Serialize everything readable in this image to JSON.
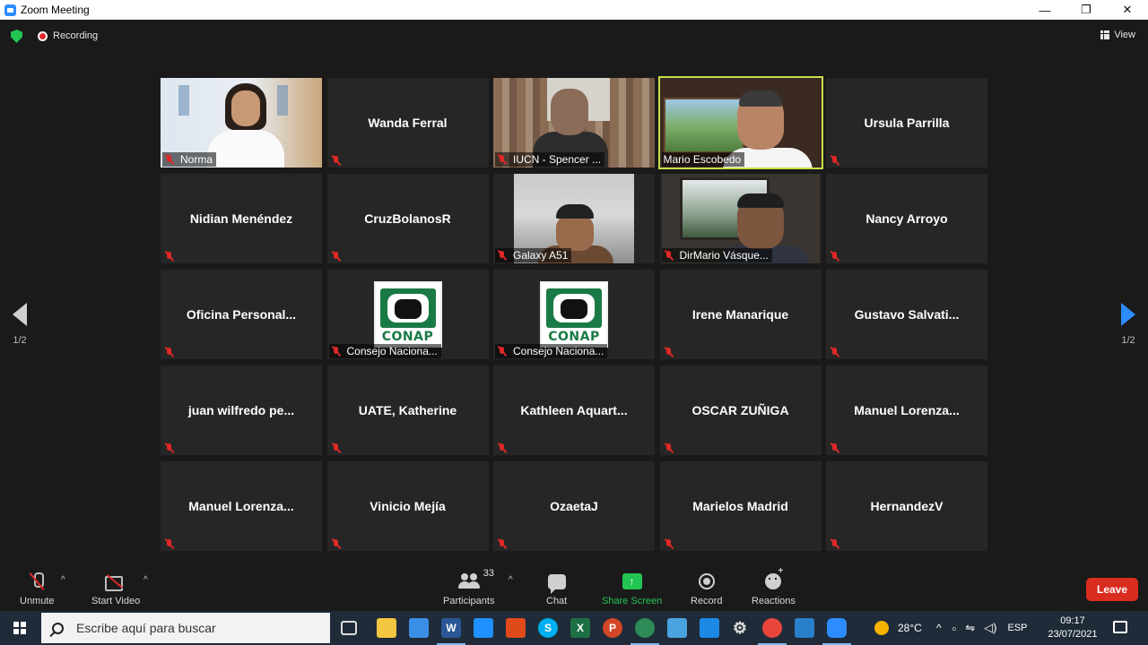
{
  "window": {
    "title": "Zoom Meeting",
    "minimize": "—",
    "restore": "❐",
    "close": "✕"
  },
  "topbar": {
    "recording_label": "Recording",
    "view_label": "View"
  },
  "pagination": {
    "prev_page": "1/2",
    "next_page": "1/2"
  },
  "participants": [
    {
      "name": "Norma",
      "type": "video"
    },
    {
      "name": "Wanda Ferral",
      "type": "name"
    },
    {
      "name": "IUCN - Spencer ...",
      "type": "video"
    },
    {
      "name": "Mario Escobedo",
      "type": "video",
      "active": true
    },
    {
      "name": "Ursula Parrilla",
      "type": "name"
    },
    {
      "name": "Nidian Menéndez",
      "type": "name"
    },
    {
      "name": "CruzBolanosR",
      "type": "name"
    },
    {
      "name": "Galaxy A51",
      "type": "video"
    },
    {
      "name": "DirMario Vásque...",
      "type": "video"
    },
    {
      "name": "Nancy Arroyo",
      "type": "name"
    },
    {
      "name": "Oficina  Personal...",
      "type": "name"
    },
    {
      "name": "Consejo Naciona...",
      "type": "logo",
      "logo_text": "CONAP"
    },
    {
      "name": "Consejo Naciona...",
      "type": "logo",
      "logo_text": "CONAP"
    },
    {
      "name": "Irene Manarique",
      "type": "name"
    },
    {
      "name": "Gustavo  Salvati...",
      "type": "name"
    },
    {
      "name": "juan  wilfredo  pe...",
      "type": "name"
    },
    {
      "name": "UATE, Katherine",
      "type": "name"
    },
    {
      "name": "Kathleen  Aquart...",
      "type": "name"
    },
    {
      "name": "OSCAR ZUÑIGA",
      "type": "name"
    },
    {
      "name": "Manuel  Lorenza...",
      "type": "name"
    },
    {
      "name": "Manuel  Lorenza...",
      "type": "name"
    },
    {
      "name": "Vinicio Mejía",
      "type": "name"
    },
    {
      "name": "OzaetaJ",
      "type": "name"
    },
    {
      "name": "Marielos Madrid",
      "type": "name"
    },
    {
      "name": "HernandezV",
      "type": "name"
    }
  ],
  "controls": {
    "unmute": "Unmute",
    "start_video": "Start Video",
    "participants": "Participants",
    "participant_count": "33",
    "chat": "Chat",
    "share_screen": "Share Screen",
    "record": "Record",
    "reactions": "Reactions",
    "leave": "Leave",
    "caret": "^"
  },
  "taskbar": {
    "search_placeholder": "Escribe aquí para buscar",
    "temperature": "28°C",
    "language": "ESP",
    "time": "09:17",
    "date": "23/07/2021"
  },
  "colors": {
    "accent_blue": "#2d8cff",
    "share_green": "#23c552",
    "leave_red": "#d92d20",
    "active_speaker": "#c7e04a",
    "muted_red": "#e02828"
  }
}
